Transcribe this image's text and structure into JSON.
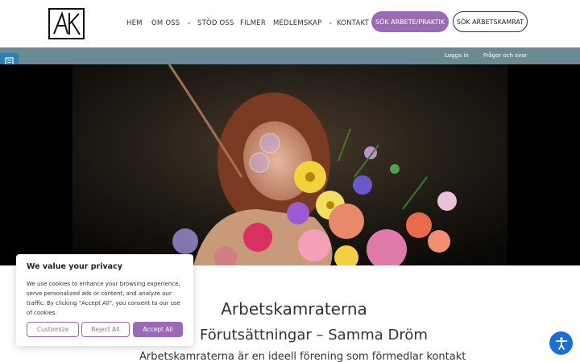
{
  "header": {
    "logo_text": "AK",
    "nav": [
      {
        "label": "HEM",
        "has_dropdown": false
      },
      {
        "label": "OM OSS",
        "has_dropdown": true
      },
      {
        "label": "STÖD OSS",
        "has_dropdown": false
      },
      {
        "label": "FILMER",
        "has_dropdown": false
      },
      {
        "label": "MEDLEMSKAP",
        "has_dropdown": true
      },
      {
        "label": "KONTAKT",
        "has_dropdown": false
      }
    ],
    "primary_button": "SÖK ARBETE/PRAKTIK",
    "secondary_button": "SÖK ARBETSKAMRAT"
  },
  "topbar": {
    "login": "Logga in",
    "faq": "Frågor och svar"
  },
  "main": {
    "title": "Arbetskamraterna",
    "subtitle": "Förutsättningar – Samma Dröm",
    "intro": "Arbetskamraterna är en ideell förening som förmedlar kontakt"
  },
  "cookie": {
    "title": "We value your privacy",
    "text": "We use cookies to enhance your browsing experience, serve personalized ads or content, and analyze our traffic. By clicking \"Accept All\", you consent to our use of cookies.",
    "customize": "Customize",
    "reject": "Reject All",
    "accept": "Accept All"
  },
  "colors": {
    "accent": "#9b6ab5",
    "topbar": "#6a8a94",
    "a11y": "#1a6fd6"
  },
  "icons": {
    "doc_tab": "document-reader-icon",
    "a11y": "accessibility-icon",
    "dropdown": "chevron-down-icon"
  }
}
